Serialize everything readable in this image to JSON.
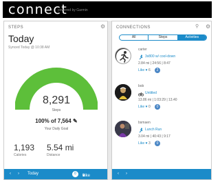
{
  "app": {
    "logo": "connect",
    "powered": "powered by Garmin"
  },
  "left": {
    "title": "STEPS",
    "heading": "Today",
    "synced": "Synced Today @ 10:38 AM",
    "steps": "8,291",
    "steps_label": "Steps",
    "percent": "100% of 7,564",
    "goal_label": "Your Daily Goal",
    "calories": "1,193",
    "calories_label": "Calories",
    "distance": "5.54 mi",
    "distance_label": "Distance",
    "goal_fraction": 1.0,
    "footer": {
      "prev": "‹",
      "next": "›",
      "day": "Today",
      "comments": "0",
      "like": "Like",
      "like_count": "0"
    }
  },
  "right": {
    "title": "CONNECTIONS",
    "tabs": [
      "All",
      "Steps",
      "Activities"
    ],
    "active_tab": "Activities",
    "entries": [
      {
        "name": "carter",
        "title": "3x800 w/ cool-down",
        "stats": "2.84 mi | 24:56 | 8:47",
        "like": "Like",
        "likes": "6",
        "comments": "2",
        "avatar": "runner"
      },
      {
        "name": "bob",
        "title": "Untitled",
        "stats": "13.86 mi | 1:03:29 | 13.40",
        "like": "Like",
        "likes": "0",
        "comments": "0",
        "avatar": "cyclist"
      },
      {
        "name": "bsmaen",
        "title": "Lunch Run",
        "stats": "3.04 mi | 40:43 | 9:17",
        "like": "Like",
        "likes": "3",
        "comments": "0",
        "avatar": "runner-photo"
      }
    ],
    "footer": {
      "prev": "‹",
      "next": "›"
    }
  },
  "colors": {
    "accent": "#1b8bc9",
    "gauge_fill": "#5dbf3a",
    "gauge_track": "#dddddd"
  }
}
